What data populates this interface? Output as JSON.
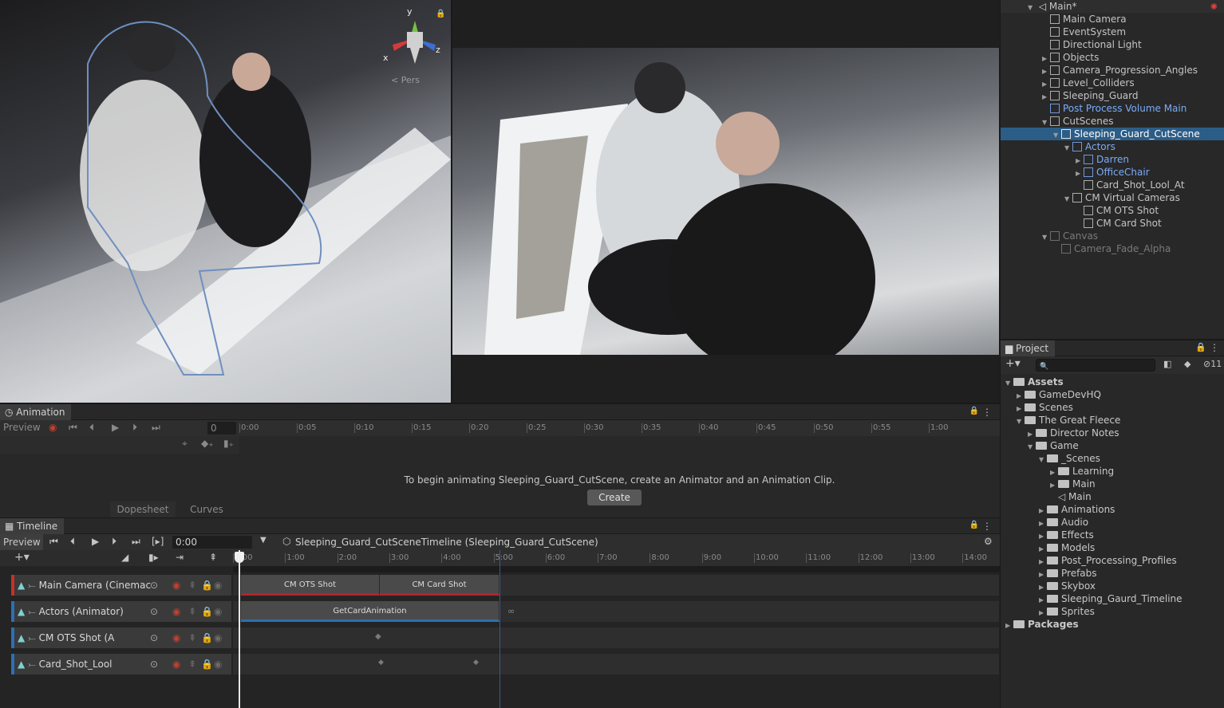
{
  "scene": {
    "gizmo_y": "y",
    "gizmo_x": "x",
    "gizmo_z": "z",
    "persp_label": "< Pers"
  },
  "hierarchy": {
    "root": "Main*",
    "items": [
      {
        "label": "Main Camera",
        "depth": 1,
        "arrow": "",
        "style": "normal"
      },
      {
        "label": "EventSystem",
        "depth": 1,
        "arrow": "",
        "style": "normal"
      },
      {
        "label": "Directional Light",
        "depth": 1,
        "arrow": "",
        "style": "normal"
      },
      {
        "label": "Objects",
        "depth": 1,
        "arrow": "▶",
        "style": "normal"
      },
      {
        "label": "Camera_Progression_Angles",
        "depth": 1,
        "arrow": "▶",
        "style": "normal"
      },
      {
        "label": "Level_Colliders",
        "depth": 1,
        "arrow": "▶",
        "style": "normal"
      },
      {
        "label": "Sleeping_Guard",
        "depth": 1,
        "arrow": "▶",
        "style": "normal"
      },
      {
        "label": "Post Process Volume Main",
        "depth": 1,
        "arrow": "",
        "style": "blue"
      },
      {
        "label": "CutScenes",
        "depth": 1,
        "arrow": "▼",
        "style": "normal"
      },
      {
        "label": "Sleeping_Guard_CutScene",
        "depth": 2,
        "arrow": "▼",
        "style": "sel"
      },
      {
        "label": "Actors",
        "depth": 3,
        "arrow": "▼",
        "style": "blue"
      },
      {
        "label": "Darren",
        "depth": 4,
        "arrow": "▶",
        "style": "blue"
      },
      {
        "label": "OfficeChair",
        "depth": 4,
        "arrow": "▶",
        "style": "blue"
      },
      {
        "label": "Card_Shot_Lool_At",
        "depth": 4,
        "arrow": "",
        "style": "normal"
      },
      {
        "label": "CM Virtual Cameras",
        "depth": 3,
        "arrow": "▼",
        "style": "normal"
      },
      {
        "label": "CM OTS Shot",
        "depth": 4,
        "arrow": "",
        "style": "normal"
      },
      {
        "label": "CM Card Shot",
        "depth": 4,
        "arrow": "",
        "style": "normal"
      },
      {
        "label": "Canvas",
        "depth": 1,
        "arrow": "▼",
        "style": "dim"
      },
      {
        "label": "Camera_Fade_Alpha",
        "depth": 2,
        "arrow": "",
        "style": "dim"
      }
    ]
  },
  "project": {
    "tab": "Project",
    "badge": "11",
    "items": [
      {
        "label": "Assets",
        "depth": 0,
        "arrow": "▼",
        "bold": true
      },
      {
        "label": "GameDevHQ",
        "depth": 1,
        "arrow": "▶"
      },
      {
        "label": "Scenes",
        "depth": 1,
        "arrow": "▶"
      },
      {
        "label": "The Great Fleece",
        "depth": 1,
        "arrow": "▼"
      },
      {
        "label": "Director Notes",
        "depth": 2,
        "arrow": "▶"
      },
      {
        "label": "Game",
        "depth": 2,
        "arrow": "▼"
      },
      {
        "label": "_Scenes",
        "depth": 3,
        "arrow": "▼"
      },
      {
        "label": "Learning",
        "depth": 4,
        "arrow": "▶"
      },
      {
        "label": "Main",
        "depth": 4,
        "arrow": "▶"
      },
      {
        "label": "Main",
        "depth": 4,
        "arrow": "",
        "unity": true
      },
      {
        "label": "Animations",
        "depth": 3,
        "arrow": "▶"
      },
      {
        "label": "Audio",
        "depth": 3,
        "arrow": "▶"
      },
      {
        "label": "Effects",
        "depth": 3,
        "arrow": "▶"
      },
      {
        "label": "Models",
        "depth": 3,
        "arrow": "▶"
      },
      {
        "label": "Post_Processing_Profiles",
        "depth": 3,
        "arrow": "▶"
      },
      {
        "label": "Prefabs",
        "depth": 3,
        "arrow": "▶"
      },
      {
        "label": "Skybox",
        "depth": 3,
        "arrow": "▶"
      },
      {
        "label": "Sleeping_Gaurd_Timeline",
        "depth": 3,
        "arrow": "▶"
      },
      {
        "label": "Sprites",
        "depth": 3,
        "arrow": "▶"
      },
      {
        "label": "Packages",
        "depth": 0,
        "arrow": "▶",
        "bold": true
      }
    ]
  },
  "animation": {
    "tab": "Animation",
    "preview": "Preview",
    "frame": "0",
    "ruler": [
      "0:00",
      "0:05",
      "0:10",
      "0:15",
      "0:20",
      "0:25",
      "0:30",
      "0:35",
      "0:40",
      "0:45",
      "0:50",
      "0:55",
      "1:00"
    ],
    "message": "To begin animating Sleeping_Guard_CutScene, create an Animator and an Animation Clip.",
    "create": "Create",
    "dopesheet": "Dopesheet",
    "curves": "Curves"
  },
  "timeline": {
    "tab": "Timeline",
    "preview": "Preview",
    "time": "0:00",
    "asset": "Sleeping_Guard_CutSceneTimeline (Sleeping_Guard_CutScene)",
    "ruler": [
      "0:00",
      "1:00",
      "2:00",
      "3:00",
      "4:00",
      "5:00",
      "6:00",
      "7:00",
      "8:00",
      "9:00",
      "10:00",
      "11:00",
      "12:00",
      "13:00",
      "14:00"
    ],
    "tracks": [
      {
        "name": "Main Camera (Cinemac",
        "color": "#c4302b"
      },
      {
        "name": "Actors (Animator)",
        "color": "#2d6fb3"
      },
      {
        "name": "CM OTS Shot (A",
        "color": "#2d6fb3"
      },
      {
        "name": "Card_Shot_Lool",
        "color": "#2d6fb3"
      }
    ],
    "clips": {
      "ots": "CM OTS Shot",
      "card": "CM Card Shot",
      "anim": "GetCardAnimation"
    }
  }
}
